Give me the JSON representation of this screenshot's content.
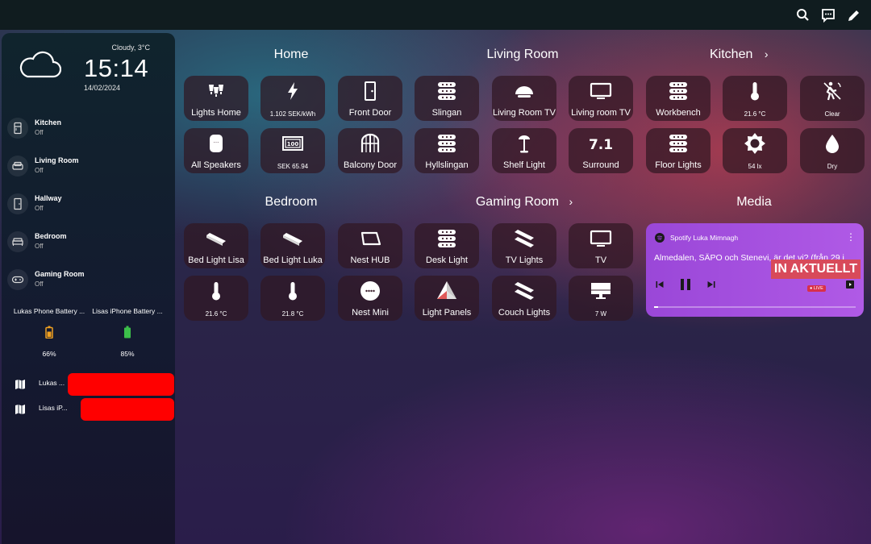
{
  "topbar": {
    "icons": [
      "search-icon",
      "assist-icon",
      "edit-icon"
    ]
  },
  "sidebar": {
    "weather": {
      "condition": "Cloudy, 3°C",
      "time": "15:14",
      "date": "14/02/2024",
      "icon": "cloudy-icon"
    },
    "rooms": [
      {
        "name": "Kitchen",
        "state": "Off",
        "icon": "fridge-icon"
      },
      {
        "name": "Living Room",
        "state": "Off",
        "icon": "sofa-icon"
      },
      {
        "name": "Hallway",
        "state": "Off",
        "icon": "door-icon"
      },
      {
        "name": "Bedroom",
        "state": "Off",
        "icon": "bed-icon"
      },
      {
        "name": "Gaming Room",
        "state": "Off",
        "icon": "gamepad-icon"
      }
    ],
    "batteries": [
      {
        "name": "Lukas Phone Battery ...",
        "value": "66%",
        "level": 0.66,
        "color": "#f0a020"
      },
      {
        "name": "Lisas iPhone Battery ...",
        "value": "85%",
        "level": 0.85,
        "color": "#3cbf4a"
      }
    ],
    "trackers": [
      {
        "name": "Lukas ...",
        "icon": "map-icon"
      },
      {
        "name": "Lisas iP...",
        "icon": "map-icon"
      }
    ]
  },
  "sections": {
    "home": "Home",
    "living_room": "Living Room",
    "kitchen": "Kitchen",
    "bedroom": "Bedroom",
    "gaming_room": "Gaming Room",
    "media": "Media"
  },
  "tiles": [
    {
      "label": "Lights Home",
      "icon": "lights-group-icon"
    },
    {
      "label": "1.102 SEK/kWh",
      "icon": "flash-icon"
    },
    {
      "label": "Front Door",
      "icon": "door-icon"
    },
    {
      "label": "Slingan",
      "icon": "led-strip-icon"
    },
    {
      "label": "Living Room TV",
      "icon": "lamp-dome-icon"
    },
    {
      "label": "Living room TV",
      "icon": "tv-icon"
    },
    {
      "label": "Workbench",
      "icon": "led-strip-icon"
    },
    {
      "label": "21.6 °C",
      "icon": "thermometer-icon"
    },
    {
      "label": "Clear",
      "icon": "motion-off-icon"
    },
    {
      "label": "All Speakers",
      "icon": "speaker-icon"
    },
    {
      "label": "SEK 65.94",
      "icon": "cash-icon"
    },
    {
      "label": "Balcony Door",
      "icon": "balcony-door-icon"
    },
    {
      "label": "Hyllslingan",
      "icon": "led-strip-icon"
    },
    {
      "label": "Shelf Light",
      "icon": "floor-lamp-icon"
    },
    {
      "label": "Surround",
      "icon": "surround-icon"
    },
    {
      "label": "Floor Lights",
      "icon": "led-strip-icon"
    },
    {
      "label": "54 lx",
      "icon": "brightness-icon"
    },
    {
      "label": "Dry",
      "icon": "water-drop-icon"
    },
    {
      "label": "Bed Light Lisa",
      "icon": "light-bar-icon"
    },
    {
      "label": "Bed Light Luka",
      "icon": "light-bar-icon"
    },
    {
      "label": "Nest HUB",
      "icon": "tablet-icon"
    },
    {
      "label": "Desk Light",
      "icon": "led-strip-icon"
    },
    {
      "label": "TV Lights",
      "icon": "light-bars-icon"
    },
    {
      "label": "TV",
      "icon": "tv-icon"
    },
    {
      "label": "21.6 °C",
      "icon": "thermometer-icon"
    },
    {
      "label": "21.8 °C",
      "icon": "thermometer-icon"
    },
    {
      "label": "Nest Mini",
      "icon": "nest-mini-icon"
    },
    {
      "label": "Light Panels",
      "icon": "triangle-panels-icon"
    },
    {
      "label": "Couch Lights",
      "icon": "light-bars-icon"
    },
    {
      "label": "7 W",
      "icon": "desktop-icon"
    }
  ],
  "media": {
    "player": "Spotify Luka Mimnagh",
    "title": "Almedalen, SÄPO och Stenevi, är det vi? (från 29 j",
    "artwork_text": "IN AKTUELLT",
    "live_badge": "● LIVE",
    "progress": 0.02
  },
  "colors": {
    "tile_bg": "#30182299",
    "media_bg": "#a752e0",
    "redaction": "#ff0000"
  }
}
